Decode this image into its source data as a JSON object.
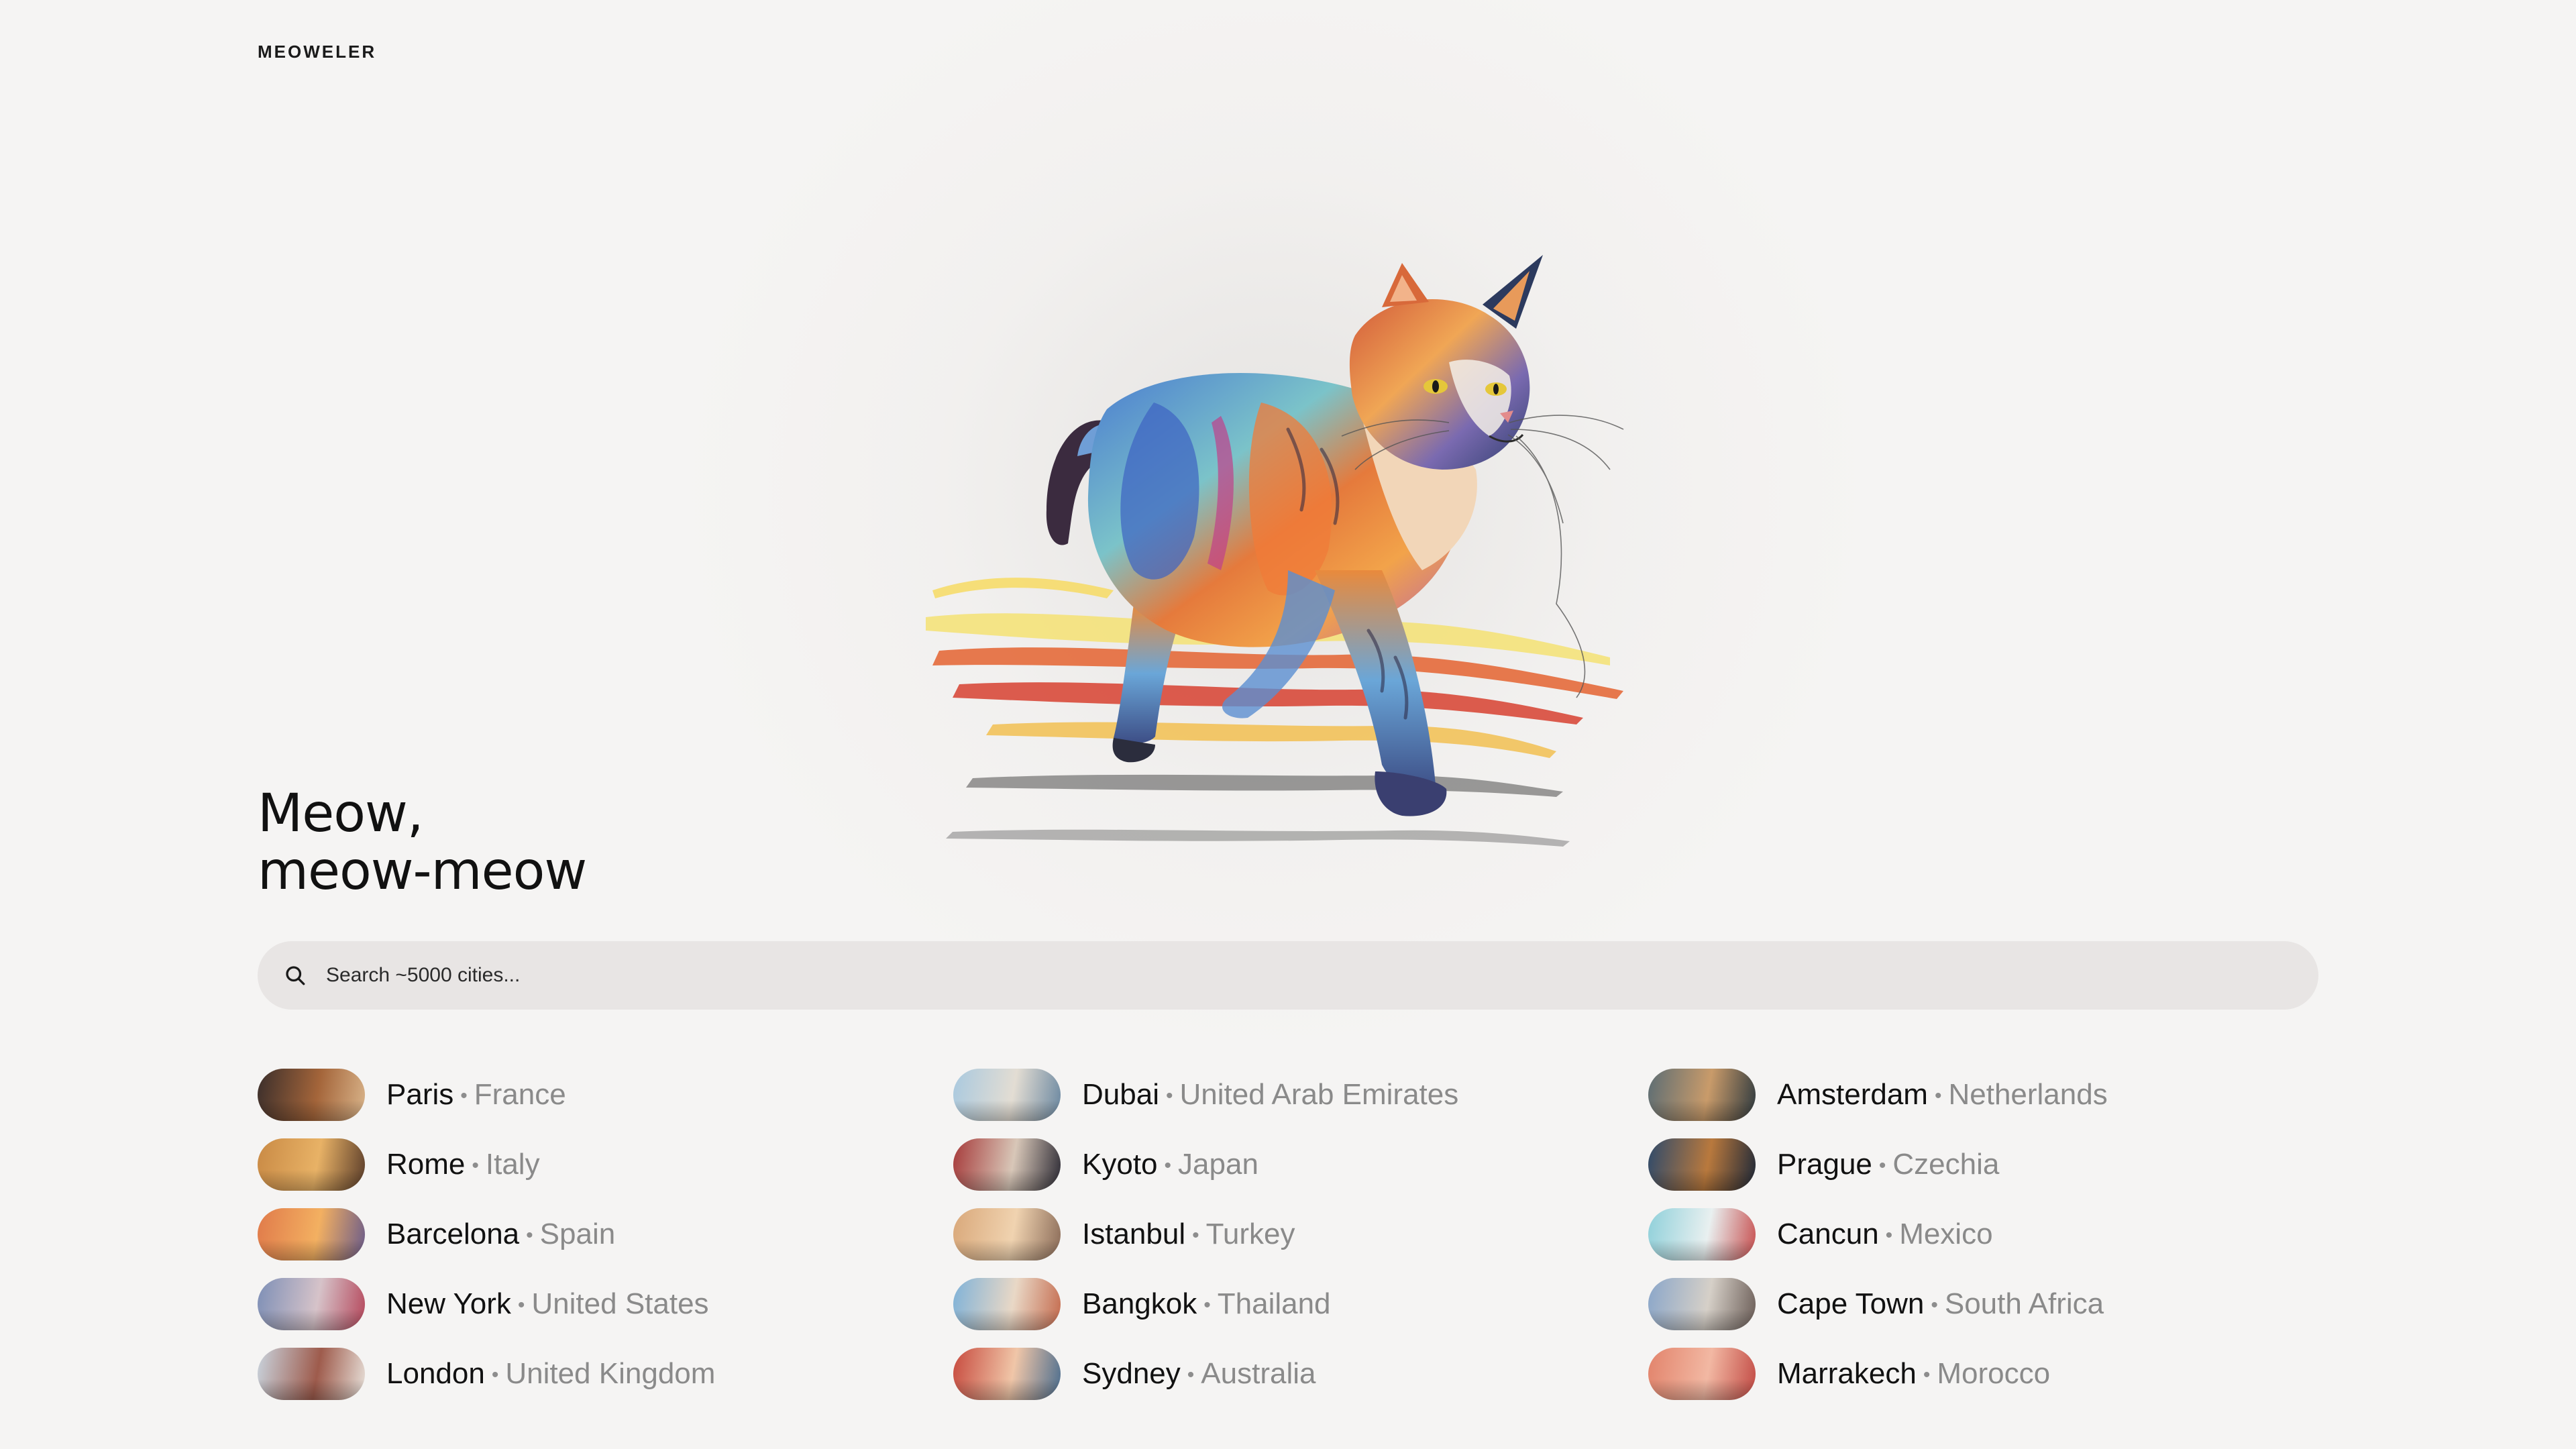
{
  "brand": {
    "logo": "MEOWELER"
  },
  "hero": {
    "headline_line1": "Meow,",
    "headline_line2": "meow-meow",
    "illustration": "colorful-walking-cat"
  },
  "search": {
    "placeholder": "Search ~5000 cities...",
    "value": "",
    "icon": "search-icon"
  },
  "separator": "•",
  "cities": {
    "col1": [
      {
        "name": "Paris",
        "country": "France",
        "colors": [
          "#3a2e2b",
          "#a4653a",
          "#d9b48a"
        ]
      },
      {
        "name": "Rome",
        "country": "Italy",
        "colors": [
          "#c98a45",
          "#e8b266",
          "#5b3d2a"
        ]
      },
      {
        "name": "Barcelona",
        "country": "Spain",
        "colors": [
          "#e07a4a",
          "#f3b061",
          "#6a5b8a"
        ]
      },
      {
        "name": "New York",
        "country": "United States",
        "colors": [
          "#7d8fb6",
          "#d6c3c9",
          "#b5475b"
        ]
      },
      {
        "name": "London",
        "country": "United Kingdom",
        "colors": [
          "#c9d4de",
          "#9e5b4c",
          "#e8e1da"
        ]
      }
    ],
    "col2": [
      {
        "name": "Dubai",
        "country": "United Arab Emirates",
        "colors": [
          "#a9c9df",
          "#e3ddd3",
          "#6a87a0"
        ]
      },
      {
        "name": "Kyoto",
        "country": "Japan",
        "colors": [
          "#a63a3a",
          "#d8c7b8",
          "#2c2a34"
        ]
      },
      {
        "name": "Istanbul",
        "country": "Turkey",
        "colors": [
          "#d9a87a",
          "#f0d3b0",
          "#8a6b58"
        ]
      },
      {
        "name": "Bangkok",
        "country": "Thailand",
        "colors": [
          "#7fb2d8",
          "#e9d8c6",
          "#c46a4d"
        ]
      },
      {
        "name": "Sydney",
        "country": "Australia",
        "colors": [
          "#c74a3e",
          "#f0c6a8",
          "#4b6d8e"
        ]
      }
    ],
    "col3": [
      {
        "name": "Amsterdam",
        "country": "Netherlands",
        "colors": [
          "#5c6d74",
          "#c99b6a",
          "#2f3a3f"
        ]
      },
      {
        "name": "Prague",
        "country": "Czechia",
        "colors": [
          "#2e4a6b",
          "#b9793d",
          "#1e2838"
        ]
      },
      {
        "name": "Cancun",
        "country": "Mexico",
        "colors": [
          "#8fd0da",
          "#e9f0f0",
          "#c74f4f"
        ]
      },
      {
        "name": "Cape Town",
        "country": "South Africa",
        "colors": [
          "#8aa6c9",
          "#d6d0c8",
          "#6b5d57"
        ]
      },
      {
        "name": "Marrakech",
        "country": "Morocco",
        "colors": [
          "#e2836b",
          "#f2b8a3",
          "#c24a44"
        ]
      }
    ]
  }
}
